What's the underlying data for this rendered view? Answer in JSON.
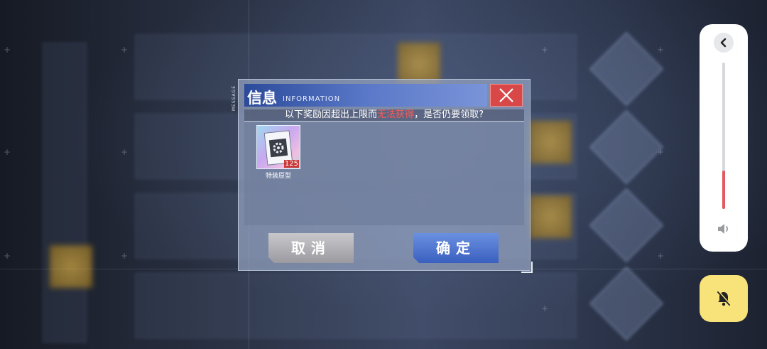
{
  "dialog": {
    "side_label": "MESSAGE",
    "title": "信息",
    "title_en": "INFORMATION",
    "message_prefix": "以下奖励因超出上限而",
    "message_warning": "无法获得",
    "message_suffix": "，是否仍要领取?",
    "items": [
      {
        "name": "特装原型",
        "count": "125",
        "icon": "equipment-blueprint-icon"
      }
    ],
    "cancel_label": "取消",
    "confirm_label": "确定"
  },
  "volume": {
    "level": 0.26,
    "back_icon": "chevron-left-icon",
    "speaker_icon": "speaker-icon",
    "mute_icon": "bell-off-icon"
  },
  "colors": {
    "title_bar": "#2c4a9a",
    "close_button": "#d84848",
    "warning_text": "#ff5a5a",
    "confirm_button": "#3a60c0",
    "cancel_button": "#9a9aa0",
    "volume_fill": "#e05a60",
    "mute_button": "#f8e27a"
  }
}
